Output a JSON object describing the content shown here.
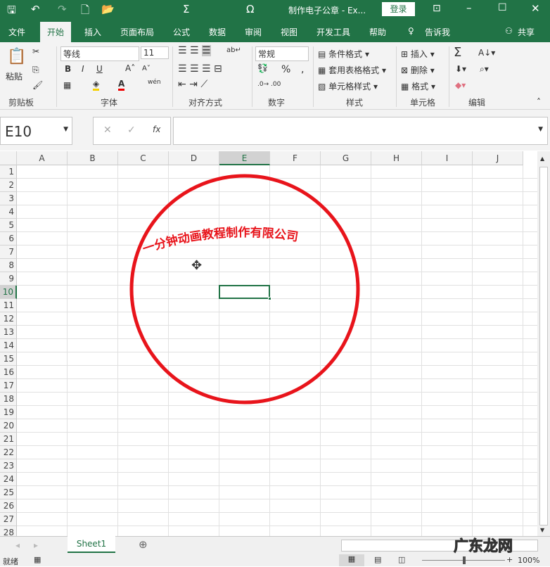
{
  "title": {
    "doc": "制作电子公章 - Ex...",
    "login": "登录"
  },
  "qat": {
    "save": "🖫",
    "undo": "↶",
    "redo": "↷",
    "new": "🗋",
    "open": "📂",
    "sum": "Σ",
    "omega": "Ω"
  },
  "tabs": [
    "文件",
    "开始",
    "插入",
    "页面布局",
    "公式",
    "数据",
    "审阅",
    "视图",
    "开发工具",
    "帮助",
    "告诉我"
  ],
  "share": "共享",
  "ribbon": {
    "clipboard": {
      "paste": "粘贴",
      "label": "剪贴板"
    },
    "font": {
      "name": "等线",
      "size": "11",
      "bold": "B",
      "italic": "I",
      "underline": "U",
      "label": "字体",
      "phonetic": "wén"
    },
    "align": {
      "label": "对齐方式"
    },
    "number": {
      "format": "常规",
      "percent": "%",
      "comma": ",",
      "label": "数字"
    },
    "styles": {
      "cond": "条件格式",
      "table": "套用表格格式",
      "cell": "单元格样式",
      "label": "样式"
    },
    "cells": {
      "insert": "插入",
      "delete": "删除",
      "format": "格式",
      "label": "单元格"
    },
    "edit": {
      "sum": "Σ",
      "label": "编辑"
    }
  },
  "formula": {
    "namebox": "E10",
    "cancel": "✕",
    "enter": "✓",
    "fx": "fx",
    "value": ""
  },
  "columns": [
    "A",
    "B",
    "C",
    "D",
    "E",
    "F",
    "G",
    "H",
    "I",
    "J"
  ],
  "rows": [
    "1",
    "2",
    "3",
    "4",
    "5",
    "6",
    "7",
    "8",
    "9",
    "10",
    "11",
    "12",
    "13",
    "14",
    "15",
    "16",
    "17",
    "18",
    "19",
    "20",
    "21",
    "22",
    "23",
    "24",
    "25",
    "26",
    "27",
    "28"
  ],
  "stamp": {
    "text": "一分钟动画教程制作有限公司",
    "color": "#e8141b"
  },
  "sheets": [
    "Sheet1"
  ],
  "status": {
    "ready": "就绪",
    "zoom": "100%"
  },
  "watermark": "广东龙网"
}
